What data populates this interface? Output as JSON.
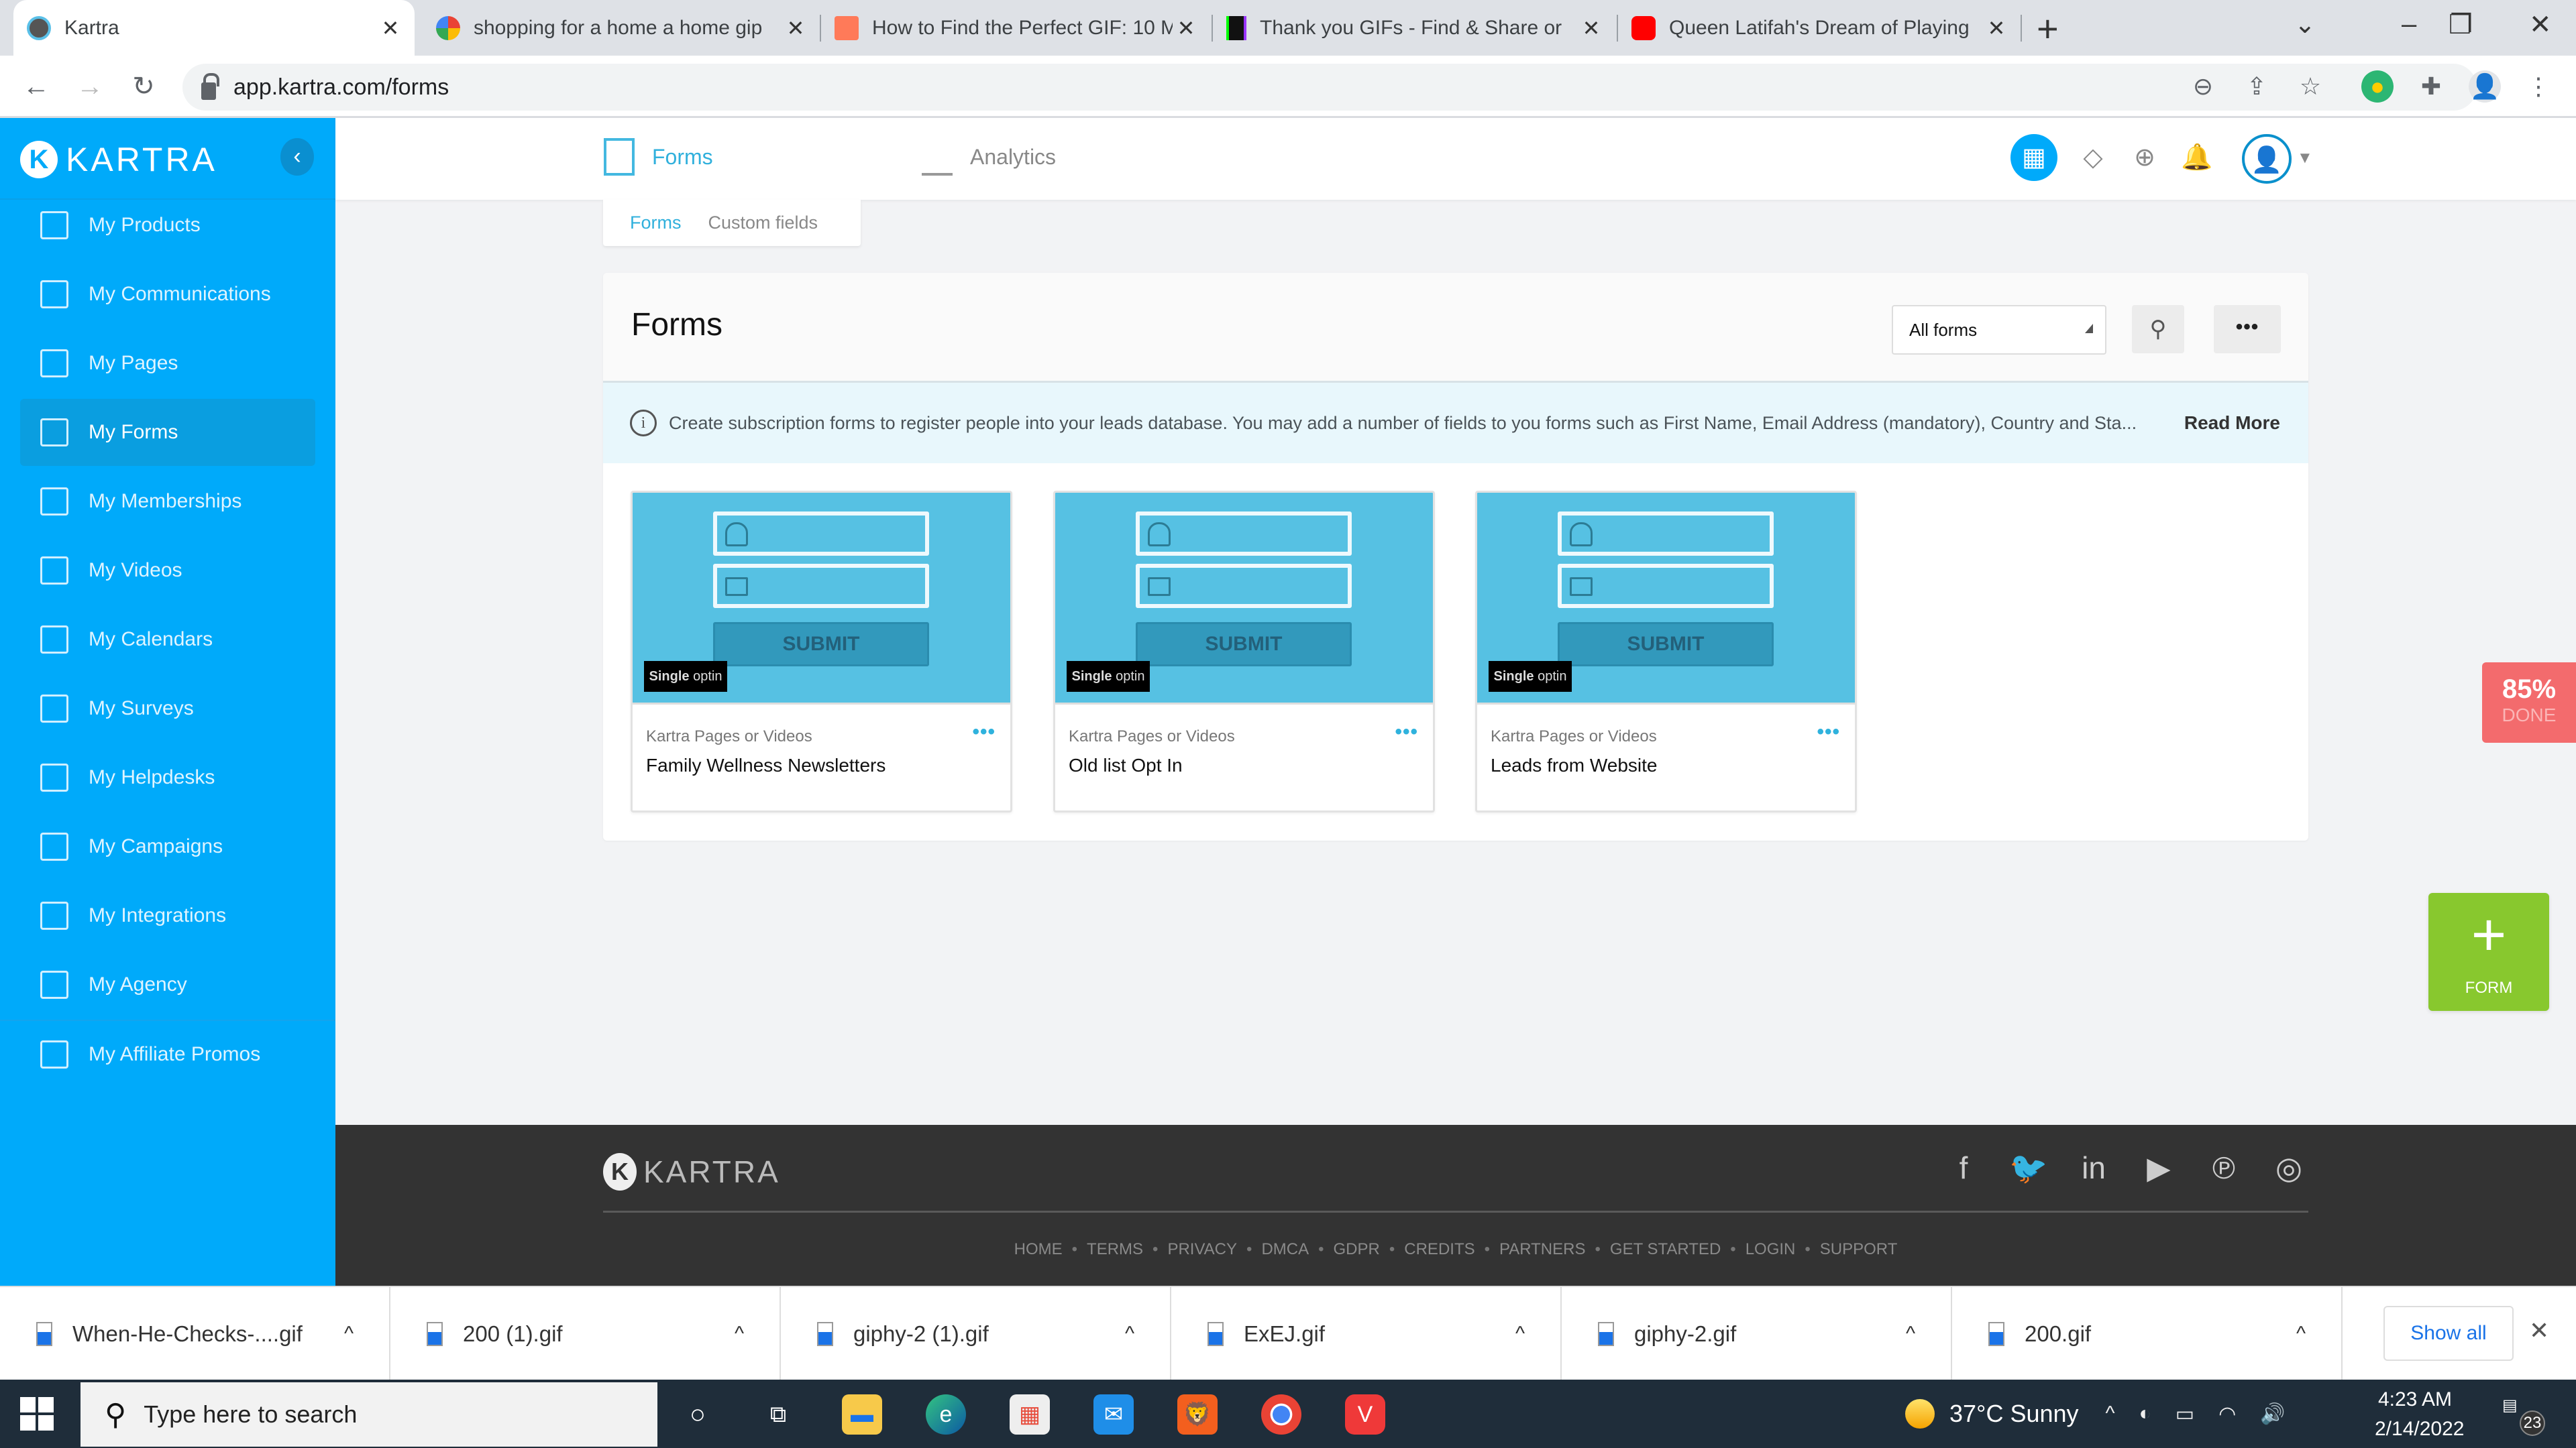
{
  "browser": {
    "tabs": [
      {
        "title": "Kartra",
        "favicon": "kartra-icon",
        "active": true
      },
      {
        "title": "shopping for a home a home gip",
        "favicon": "google-icon",
        "active": false
      },
      {
        "title": "How to Find the Perfect GIF: 10 M",
        "favicon": "hubspot-icon",
        "active": false
      },
      {
        "title": "Thank you GIFs - Find & Share or",
        "favicon": "giphy-icon",
        "active": false
      },
      {
        "title": "Queen Latifah's Dream of Playing",
        "favicon": "youtube-icon",
        "active": false
      }
    ],
    "new_tab_label": "+",
    "url": "app.kartra.com/forms",
    "window_controls": {
      "dropdown": "⌄",
      "minimize": "–",
      "restore": "❐",
      "close": "✕"
    }
  },
  "app": {
    "logo_text": "KARTRA",
    "collapse_icon": "‹",
    "sidebar": {
      "items": [
        {
          "label": "My Products",
          "icon": "cart-icon",
          "active": false
        },
        {
          "label": "My Communications",
          "icon": "communications-icon",
          "active": false
        },
        {
          "label": "My Pages",
          "icon": "http-page-icon",
          "active": false
        },
        {
          "label": "My Forms",
          "icon": "form-edit-icon",
          "active": true
        },
        {
          "label": "My Memberships",
          "icon": "members-icon",
          "active": false
        },
        {
          "label": "My Videos",
          "icon": "video-camera-icon",
          "active": false
        },
        {
          "label": "My Calendars",
          "icon": "calendar-icon",
          "active": false
        },
        {
          "label": "My Surveys",
          "icon": "survey-check-icon",
          "active": false
        },
        {
          "label": "My Helpdesks",
          "icon": "headset-icon",
          "active": false
        },
        {
          "label": "My Campaigns",
          "icon": "campaigns-icon",
          "active": false
        },
        {
          "label": "My Integrations",
          "icon": "share-nodes-icon",
          "active": false
        },
        {
          "label": "My Agency",
          "icon": "buildings-icon",
          "active": false
        },
        {
          "label": "My Affiliate Promos",
          "icon": "megaphone-icon",
          "active": false
        }
      ]
    },
    "header": {
      "tabs": [
        {
          "label": "Forms",
          "active": true
        },
        {
          "label": "Analytics",
          "active": false
        }
      ]
    },
    "subtabs": [
      {
        "label": "Forms",
        "active": true
      },
      {
        "label": "Custom fields",
        "active": false
      }
    ],
    "panel": {
      "title": "Forms",
      "filter_value": "All forms",
      "search_icon": "⚲",
      "more_label": "•••",
      "info_icon": "i",
      "info_text": "Create subscription forms to register people into your leads database. You may add a number of fields to you forms such as First Name, Email Address (mandatory), Country and Sta...",
      "read_more": "Read More"
    },
    "cards": [
      {
        "badge_bold": "Single",
        "badge_light": "optin",
        "submit": "SUBMIT",
        "source": "Kartra Pages or Videos",
        "name": "Family Wellness Newsletters",
        "menu": "•••"
      },
      {
        "badge_bold": "Single",
        "badge_light": "optin",
        "submit": "SUBMIT",
        "source": "Kartra Pages or Videos",
        "name": "Old list Opt In",
        "menu": "•••"
      },
      {
        "badge_bold": "Single",
        "badge_light": "optin",
        "submit": "SUBMIT",
        "source": "Kartra Pages or Videos",
        "name": "Leads from Website",
        "menu": "•••"
      }
    ],
    "progress": {
      "percent": 85,
      "percent_label": "85%",
      "done_label": "DONE"
    },
    "add_form": {
      "plus": "+",
      "label": "FORM"
    },
    "footer": {
      "logo_text": "KARTRA",
      "social": [
        {
          "name": "facebook-icon",
          "glyph": "f"
        },
        {
          "name": "twitter-icon",
          "glyph": "🐦"
        },
        {
          "name": "linkedin-icon",
          "glyph": "in"
        },
        {
          "name": "youtube-icon",
          "glyph": "▶"
        },
        {
          "name": "pinterest-icon",
          "glyph": "℗"
        },
        {
          "name": "instagram-icon",
          "glyph": "◎"
        }
      ],
      "links": [
        "HOME",
        "TERMS",
        "PRIVACY",
        "DMCA",
        "GDPR",
        "CREDITS",
        "PARTNERS",
        "GET STARTED",
        "LOGIN",
        "SUPPORT"
      ],
      "link_separator": "•"
    }
  },
  "downloads": {
    "items": [
      {
        "filename": "When-He-Checks-....gif"
      },
      {
        "filename": "200 (1).gif"
      },
      {
        "filename": "giphy-2 (1).gif"
      },
      {
        "filename": "ExEJ.gif"
      },
      {
        "filename": "giphy-2.gif"
      },
      {
        "filename": "200.gif"
      }
    ],
    "chevron": "^",
    "show_all": "Show all",
    "close": "✕"
  },
  "taskbar": {
    "search_placeholder": "Type here to search",
    "weather": "37°C  Sunny",
    "time": "4:23 AM",
    "date": "2/14/2022",
    "notifications_count": "23"
  }
}
